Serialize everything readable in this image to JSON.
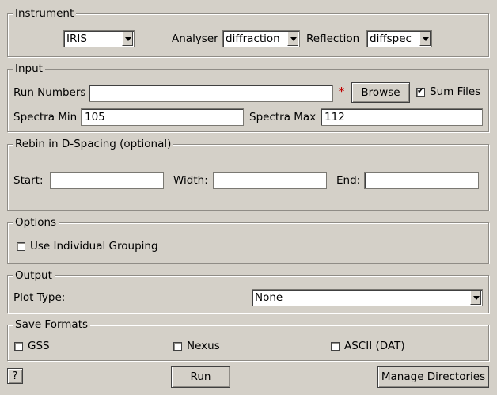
{
  "instrument": {
    "title": "Instrument",
    "instrument_value": "IRIS",
    "analyser_label": "Analyser",
    "analyser_value": "diffraction",
    "reflection_label": "Reflection",
    "reflection_value": "diffspec"
  },
  "input": {
    "title": "Input",
    "run_numbers_label": "Run Numbers",
    "run_numbers_value": "",
    "required_marker": "*",
    "browse_label": "Browse",
    "sum_files_label": "Sum Files",
    "sum_files_checked": true,
    "spectra_min_label": "Spectra Min",
    "spectra_min_value": "105",
    "spectra_max_label": "Spectra Max",
    "spectra_max_value": "112"
  },
  "rebin": {
    "title": "Rebin in D-Spacing (optional)",
    "start_label": "Start:",
    "start_value": "",
    "width_label": "Width:",
    "width_value": "",
    "end_label": "End:",
    "end_value": ""
  },
  "options": {
    "title": "Options",
    "individual_grouping_label": "Use Individual Grouping",
    "individual_grouping_checked": false
  },
  "output": {
    "title": "Output",
    "plot_type_label": "Plot Type:",
    "plot_type_value": "None"
  },
  "save_formats": {
    "title": "Save Formats",
    "gss_label": "GSS",
    "nexus_label": "Nexus",
    "ascii_label": "ASCII (DAT)"
  },
  "footer": {
    "help_label": "?",
    "run_label": "Run",
    "manage_label": "Manage Directories"
  }
}
